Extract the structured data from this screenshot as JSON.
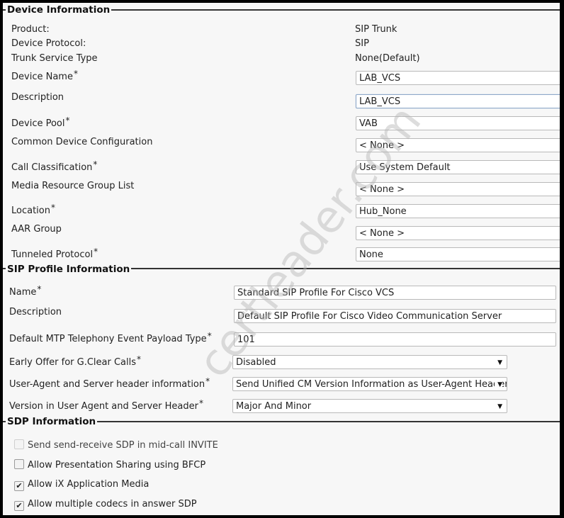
{
  "device_information": {
    "title": "Device Information",
    "product": {
      "label": "Product:",
      "value": "SIP Trunk"
    },
    "device_protocol": {
      "label": "Device Protocol:",
      "value": "SIP"
    },
    "trunk_service_type": {
      "label": "Trunk Service Type",
      "value": "None(Default)"
    },
    "device_name": {
      "label": "Device Name",
      "required": "*",
      "value": "LAB_VCS"
    },
    "description": {
      "label": "Description",
      "value": "LAB_VCS"
    },
    "device_pool": {
      "label": "Device Pool",
      "required": "*",
      "value": "VAB"
    },
    "common_device_configuration": {
      "label": "Common Device Configuration",
      "value": "< None >"
    },
    "call_classification": {
      "label": "Call Classification",
      "required": "*",
      "value": "Use System Default"
    },
    "media_resource_group_list": {
      "label": "Media Resource Group List",
      "value": "< None >"
    },
    "location": {
      "label": "Location",
      "required": "*",
      "value": "Hub_None"
    },
    "aar_group": {
      "label": "AAR Group",
      "value": "< None >"
    },
    "tunneled_protocol": {
      "label": "Tunneled Protocol",
      "required": "*",
      "value": "None"
    }
  },
  "sip_profile_information": {
    "title": "SIP Profile Information",
    "name": {
      "label": "Name",
      "required": "*",
      "value": "Standard SIP Profile For Cisco VCS"
    },
    "description": {
      "label": "Description",
      "value": "Default SIP Profile For Cisco Video Communication Server"
    },
    "default_mtp_payload_type": {
      "label": "Default MTP Telephony Event Payload Type",
      "required": "*",
      "value": "101"
    },
    "early_offer_gclear": {
      "label": "Early Offer for G.Clear Calls",
      "required": "*",
      "value": "Disabled"
    },
    "user_agent_server_header_info": {
      "label": "User-Agent and Server header information",
      "required": "*",
      "value": "Send Unified CM Version Information as User-Agent Header"
    },
    "version_in_user_agent": {
      "label": "Version in User Agent and Server Header",
      "required": "*",
      "value": "Major And Minor"
    },
    "dropdown_arrow": "▼"
  },
  "sdp_information": {
    "title": "SDP Information",
    "options": [
      {
        "label": "Send send-receive SDP in mid-call INVITE",
        "checked": false,
        "disabled": true
      },
      {
        "label": "Allow Presentation Sharing using BFCP",
        "checked": false,
        "disabled": false
      },
      {
        "label": "Allow iX Application Media",
        "checked": true,
        "disabled": false
      },
      {
        "label": "Allow multiple codecs in answer SDP",
        "checked": true,
        "disabled": false
      }
    ],
    "check_glyph": "✔"
  },
  "watermark": "certleader.com"
}
